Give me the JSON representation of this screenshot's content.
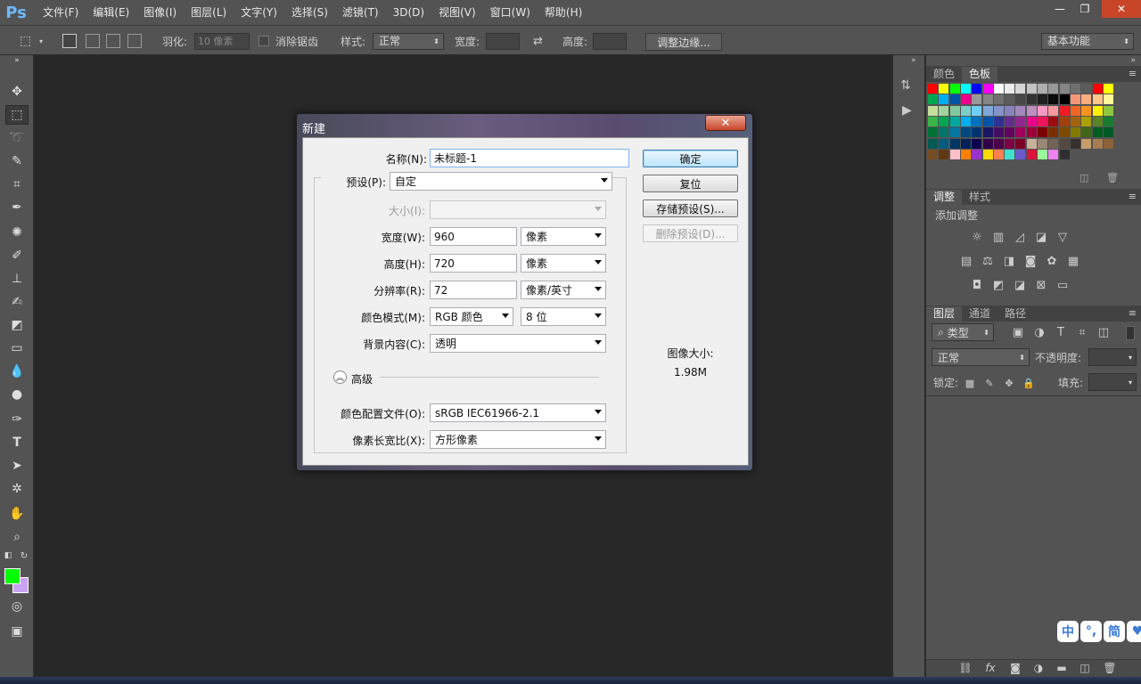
{
  "app": {
    "logo": "Ps"
  },
  "menu": [
    "文件(F)",
    "编辑(E)",
    "图像(I)",
    "图层(L)",
    "文字(Y)",
    "选择(S)",
    "滤镜(T)",
    "3D(D)",
    "视图(V)",
    "窗口(W)",
    "帮助(H)"
  ],
  "window_controls": {
    "minimize": "—",
    "restore": "❐",
    "close": "✕"
  },
  "options": {
    "feather_label": "羽化:",
    "feather_placeholder": "10 像素",
    "antialias_label": "消除锯齿",
    "style_label": "样式:",
    "style_value": "正常",
    "width_label": "宽度:",
    "height_label": "高度:",
    "refine_edge": "调整边缘...",
    "workspace": "基本功能"
  },
  "panels": {
    "collapse_icon": "»",
    "swatch_tabs": [
      "颜色",
      "色板"
    ],
    "adjust_tabs": [
      "调整",
      "样式"
    ],
    "adjust_title": "添加调整",
    "layer_tabs": [
      "图层",
      "通道",
      "路径"
    ],
    "layer_kind": "类型",
    "blend_mode": "正常",
    "opacity_label": "不透明度:",
    "lock_label": "锁定:",
    "fill_label": "填充:",
    "swatch_colors": [
      [
        "#ff0000",
        "#ffff00",
        "#00ff00",
        "#00ffff",
        "#0000ff",
        "#ff00ff",
        "#ffffff",
        "#ebebeb",
        "#d6d6d6",
        "#c2c2c2",
        "#adadad",
        "#999999",
        "#858585",
        "#707070",
        "#5c5c5c",
        "#ff0000",
        "#ffff00"
      ],
      [
        "#00a651",
        "#00aeef",
        "#0054a6",
        "#ec008c",
        "#999999",
        "#858585",
        "#707070",
        "#5c5c5c",
        "#474747",
        "#333333",
        "#1f1f1f",
        "#0a0a0a",
        "#000000",
        "#f7977a",
        "#f9ad81",
        "#fdc68a",
        "#fff79a"
      ],
      [
        "#c4df9b",
        "#a3d39c",
        "#82ca9d",
        "#7bcdc8",
        "#6ecff6",
        "#7ea7d8",
        "#8493ca",
        "#8882be",
        "#a187be",
        "#bc8dbf",
        "#f49ac2",
        "#f6989d",
        "#ed1c24",
        "#f26522",
        "#f7941d",
        "#fff200",
        "#8dc73f"
      ],
      [
        "#39b54a",
        "#00a651",
        "#00a99d",
        "#00aeef",
        "#0072bc",
        "#0054a6",
        "#2e3192",
        "#662d91",
        "#92278f",
        "#ec008c",
        "#ed145b",
        "#9e0b0f",
        "#a0410d",
        "#a36209",
        "#aba000",
        "#598527",
        "#197b30"
      ],
      [
        "#007236",
        "#00746b",
        "#0076a3",
        "#004a80",
        "#003471",
        "#1b1464",
        "#440e62",
        "#630460",
        "#9e005d",
        "#9e0039",
        "#790000",
        "#7b2e00",
        "#7d4900",
        "#827b00",
        "#406618",
        "#005e20",
        "#005826"
      ],
      [
        "#005952",
        "#005b7f",
        "#003663",
        "#002157",
        "#0d004c",
        "#32004b",
        "#4b0049",
        "#7b0046",
        "#7a0026",
        "#c7b299",
        "#998675",
        "#736357",
        "#534741",
        "#37302d",
        "#c69c6d",
        "#a67c52",
        "#8c6239"
      ],
      [
        "#754c24",
        "#603913",
        "#ffc0cb",
        "#ff8000",
        "#9932cc",
        "#ffd700",
        "#ff7f50",
        "#40e0d0",
        "#6a5acd",
        "#dc143c",
        "#98fb98",
        "#ee82ee",
        "#2f2f2f"
      ]
    ]
  },
  "dialog": {
    "title": "新建",
    "close": "✕",
    "name_label": "名称(N):",
    "name_value": "未标题-1",
    "preset_label": "预设(P):",
    "preset_value": "自定",
    "size_label": "大小(I):",
    "width_label": "宽度(W):",
    "width_value": "960",
    "width_unit": "像素",
    "height_label": "高度(H):",
    "height_value": "720",
    "height_unit": "像素",
    "resolution_label": "分辨率(R):",
    "resolution_value": "72",
    "resolution_unit": "像素/英寸",
    "color_mode_label": "颜色模式(M):",
    "color_mode_value": "RGB 颜色",
    "bit_depth_value": "8 位",
    "background_label": "背景内容(C):",
    "background_value": "透明",
    "advanced_label": "高级",
    "color_profile_label": "颜色配置文件(O):",
    "color_profile_value": "sRGB IEC61966-2.1",
    "aspect_label": "像素长宽比(X):",
    "aspect_value": "方形像素",
    "ok": "确定",
    "reset": "复位",
    "save_preset": "存储预设(S)...",
    "delete_preset": "删除预设(D)...",
    "image_size_label": "图像大小:",
    "image_size_value": "1.98M"
  },
  "ime": [
    "中",
    "°,",
    "简",
    "♥"
  ],
  "colors": {
    "foreground": "#00ff00",
    "background": "#c9a2f2"
  }
}
